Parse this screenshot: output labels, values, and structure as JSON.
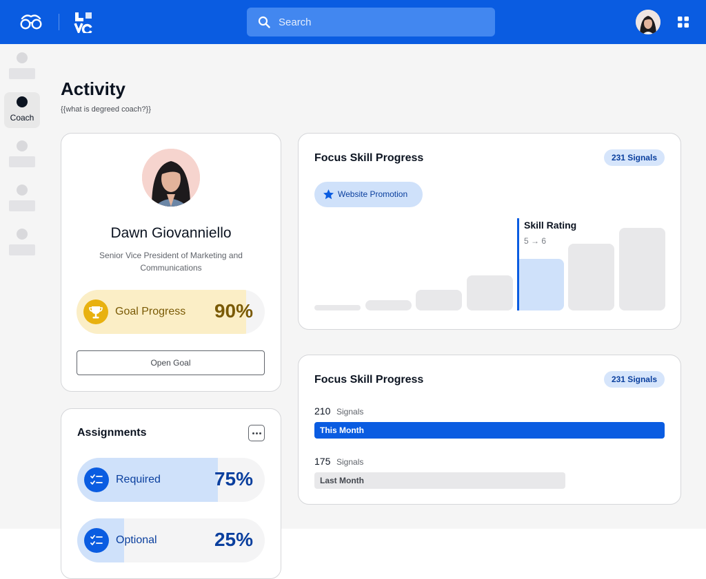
{
  "header": {
    "search_placeholder": "Search",
    "accent_color": "#0a5ce1",
    "icons": [
      "glasses-logo-icon",
      "brand-logo-icon",
      "search-icon",
      "user-avatar",
      "apps-grid-icon"
    ]
  },
  "sidebar": {
    "active_item_label": "Coach"
  },
  "page": {
    "title": "Activity",
    "subtitle": "{{what is degreed coach?}}"
  },
  "profile": {
    "name": "Dawn Giovanniello",
    "role": "Senior Vice President of Marketing and Communications",
    "goal_label": "Goal Progress",
    "goal_value": "90%",
    "goal_fraction": 0.9,
    "open_goal_label": "Open Goal"
  },
  "assignments": {
    "title": "Assignments",
    "items": [
      {
        "label": "Required",
        "value": "75%",
        "fraction": 0.75
      },
      {
        "label": "Optional",
        "value": "25%",
        "fraction": 0.25
      }
    ]
  },
  "focus_skill_chart": {
    "title": "Focus Skill Progress",
    "signals_badge": "231 Signals",
    "skill_tag": "Website Promotion",
    "rating_title": "Skill Rating",
    "rating_range": "5 → 6",
    "active_level": 5,
    "levels": [
      1,
      2,
      3,
      4,
      5,
      6,
      7
    ]
  },
  "focus_skill_signals": {
    "title": "Focus Skill Progress",
    "signals_badge": "231 Signals",
    "rows": [
      {
        "count": "210",
        "unit": "Signals",
        "label": "This Month",
        "value": 210
      },
      {
        "count": "175",
        "unit": "Signals",
        "label": "Last Month",
        "value": 175
      }
    ]
  }
}
